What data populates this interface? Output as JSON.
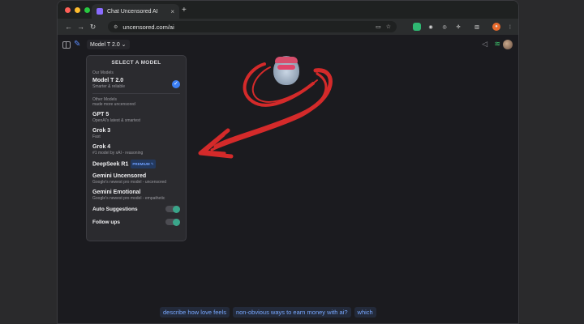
{
  "browser": {
    "tab_title": "Chat Uncensored AI",
    "url": "uncensored.com/ai",
    "new_tab_label": "+",
    "tab_close_label": "×"
  },
  "header": {
    "model_selector_label": "Model T 2.0",
    "model_selector_chevron": "⌄"
  },
  "model_menu": {
    "heading": "SELECT A MODEL",
    "our_models_label": "Our Models",
    "our_models": [
      {
        "name": "Model T 2.0",
        "description": "Smarter & reliable",
        "selected": true
      }
    ],
    "other_models_label": "Other Models",
    "other_models_subtitle": "made more uncensored",
    "other_models": [
      {
        "name": "GPT 5",
        "description": "OpenAI's latest & smartest"
      },
      {
        "name": "Grok 3",
        "description": "Fast"
      },
      {
        "name": "Grok 4",
        "description": "#1 model by xAI - reasoning"
      },
      {
        "name": "DeepSeek R1",
        "description": "",
        "badge": "PREMIUM"
      },
      {
        "name": "Gemini Uncensored",
        "description": "Google's newest pro model - uncensored"
      },
      {
        "name": "Gemini Emotional",
        "description": "Google's newest pro model - empathetic"
      }
    ],
    "toggles": [
      {
        "label": "Auto Suggestions",
        "on": true
      },
      {
        "label": "Follow ups",
        "on": true
      }
    ]
  },
  "suggestions": [
    "describe how love feels",
    "non-obvious ways to earn money with ai?",
    "which"
  ],
  "colors": {
    "accent_blue": "#3b7ff5",
    "annotation_red": "#d42a2a",
    "toggle_on": "#3aa58a"
  }
}
